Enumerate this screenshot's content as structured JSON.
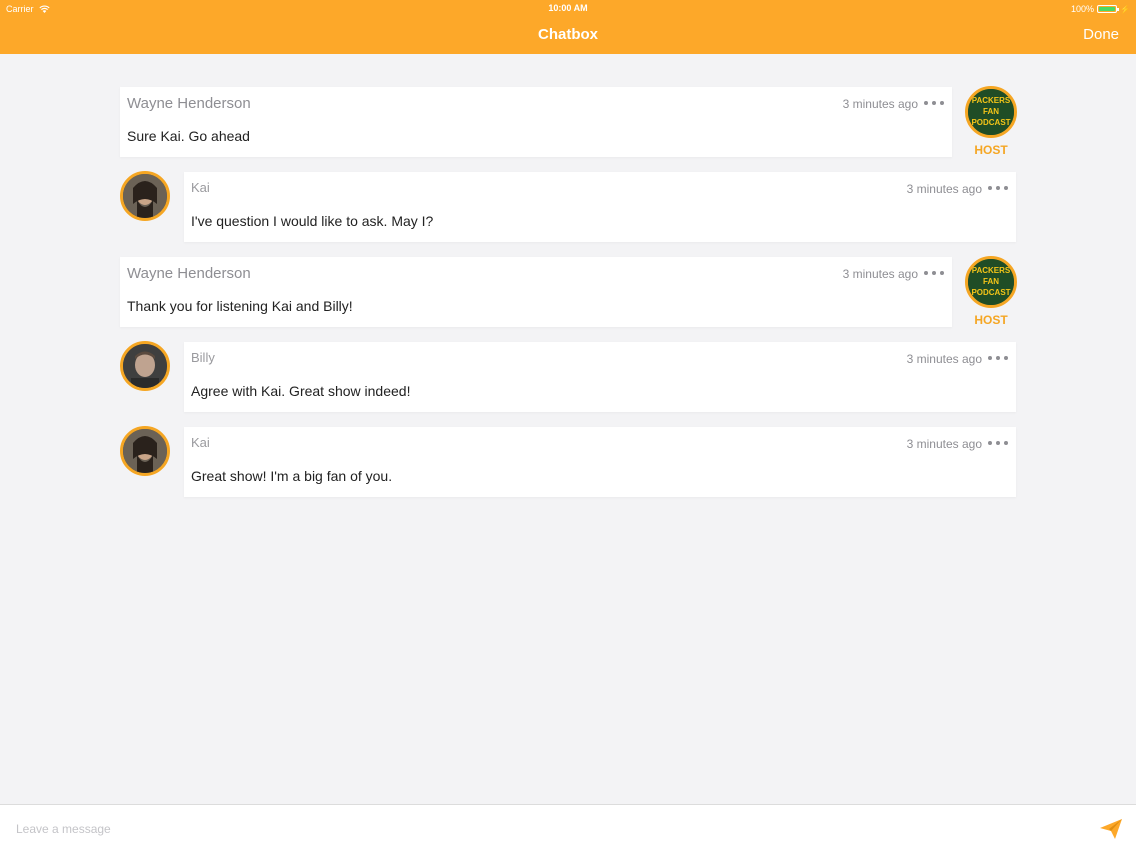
{
  "status_bar": {
    "carrier": "Carrier",
    "time": "10:00 AM",
    "battery": "100%",
    "battery_level": 1.0
  },
  "nav": {
    "title": "Chatbox",
    "done_label": "Done"
  },
  "host_badge": {
    "logo_lines": [
      "PACKERS",
      "FAN",
      "PODCAST"
    ],
    "label": "HOST"
  },
  "messages": [
    {
      "author": "Wayne Henderson",
      "role": "host",
      "time": "3 minutes ago",
      "text": "Sure Kai. Go ahead"
    },
    {
      "author": "Kai",
      "role": "guest",
      "time": "3 minutes ago",
      "text": "I've question I would like to ask. May I?"
    },
    {
      "author": "Wayne Henderson",
      "role": "host",
      "time": "3 minutes ago",
      "text": "Thank you for listening Kai and Billy!"
    },
    {
      "author": "Billy",
      "role": "guest",
      "time": "3 minutes ago",
      "text": "Agree with Kai. Great show indeed!"
    },
    {
      "author": "Kai",
      "role": "guest",
      "time": "3 minutes ago",
      "text": "Great show! I'm a big fan of you."
    }
  ],
  "composer": {
    "placeholder": "Leave a message",
    "value": ""
  },
  "colors": {
    "accent": "#fda829",
    "avatar_ring": "#f5a623",
    "battery": "#4cd964"
  },
  "icons": {
    "wifi": "wifi-icon",
    "more": "more-dots-icon",
    "send": "paper-plane-icon"
  }
}
